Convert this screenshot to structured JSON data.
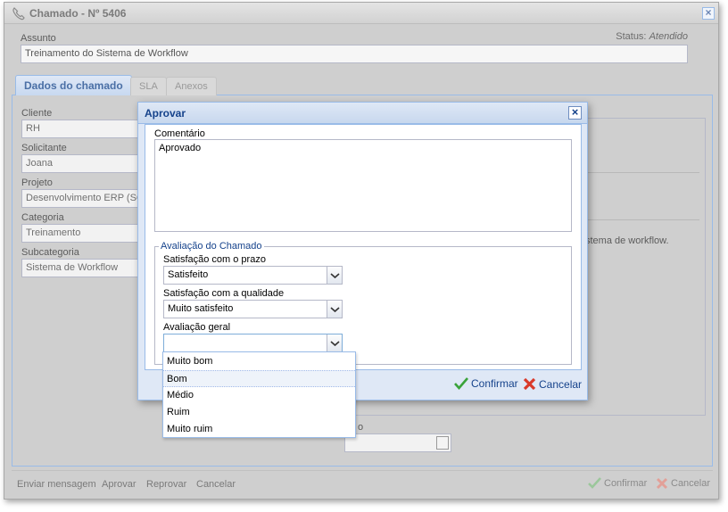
{
  "window": {
    "title": "Chamado - Nº 5406",
    "subject_label": "Assunto",
    "subject_value": "Treinamento do Sistema de Workflow",
    "status_label": "Status:",
    "status_value": "Atendido"
  },
  "tabs": [
    {
      "label": "Dados do chamado"
    },
    {
      "label": "SLA"
    },
    {
      "label": "Anexos"
    }
  ],
  "fields": {
    "cliente": {
      "label": "Cliente",
      "value": "RH"
    },
    "solicitante": {
      "label": "Solicitante",
      "value": "Joana"
    },
    "projeto": {
      "label": "Projeto",
      "value": "Desenvolvimento ERP (SCP"
    },
    "categoria": {
      "label": "Categoria",
      "value": "Treinamento"
    },
    "subcategoria": {
      "label": "Subcategoria",
      "value": "Sistema de Workflow"
    }
  },
  "background_text": {
    "description_fragment": "stema de workflow.",
    "date_label_fragment": "o"
  },
  "bottom_bar": {
    "links": [
      "Enviar mensagem",
      "Aprovar",
      "Reprovar",
      "Cancelar"
    ],
    "confirm": "Confirmar",
    "cancel": "Cancelar"
  },
  "dialog": {
    "title": "Aprovar",
    "comment_label": "Comentário",
    "comment_value": "Aprovado",
    "fieldset_legend": "Avaliação do Chamado",
    "prazo_label": "Satisfação com o prazo",
    "prazo_value": "Satisfeito",
    "qualidade_label": "Satisfação com a qualidade",
    "qualidade_value": "Muito satisfeito",
    "geral_label": "Avaliação geral",
    "geral_value": "",
    "confirm": "Confirmar",
    "cancel": "Cancelar"
  },
  "dropdown": {
    "options": [
      "Muito bom",
      "Bom",
      "Médio",
      "Ruim",
      "Muito ruim"
    ],
    "highlighted": "Bom"
  },
  "colors": {
    "title_blue": "#15428b",
    "confirm_green": "#3aa33a",
    "cancel_red": "#d93a2b"
  }
}
